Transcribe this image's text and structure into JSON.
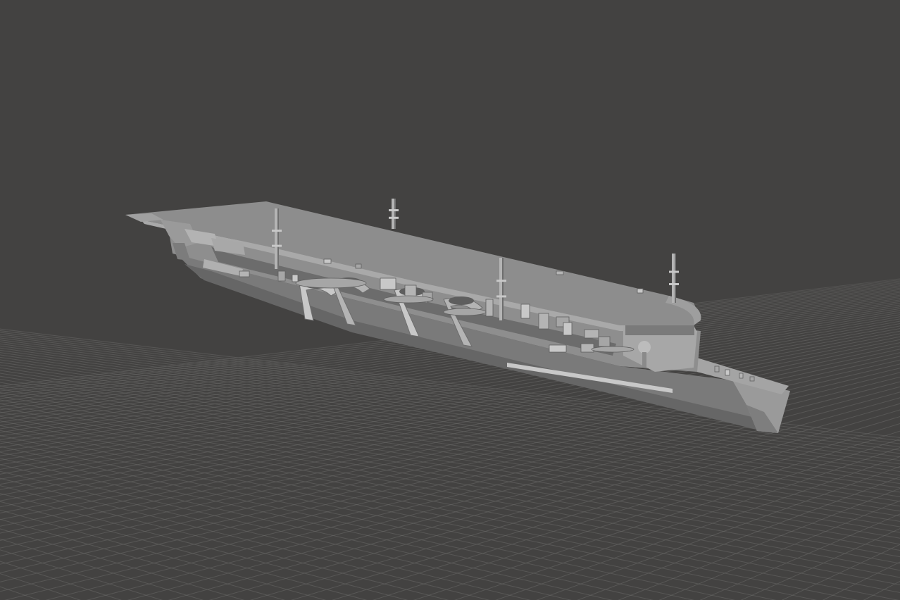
{
  "viewport": {
    "background_color": "#434241",
    "grid_line_color": "#6a6967",
    "grid_line_faint_color": "#555452",
    "grid_visible": true
  },
  "model": {
    "subject": "aircraft-carrier",
    "hull_color": "#8a8a8a",
    "hull_dark_color": "#6e6e6e",
    "deck_color": "#8c8c8c",
    "deck_side_color": "#a6a6a6",
    "detail_color": "#b4b4b4",
    "detail_dark_color": "#5e5e5e",
    "highlight_color": "#c8c8c8",
    "masts": 4,
    "funnels": 4
  }
}
